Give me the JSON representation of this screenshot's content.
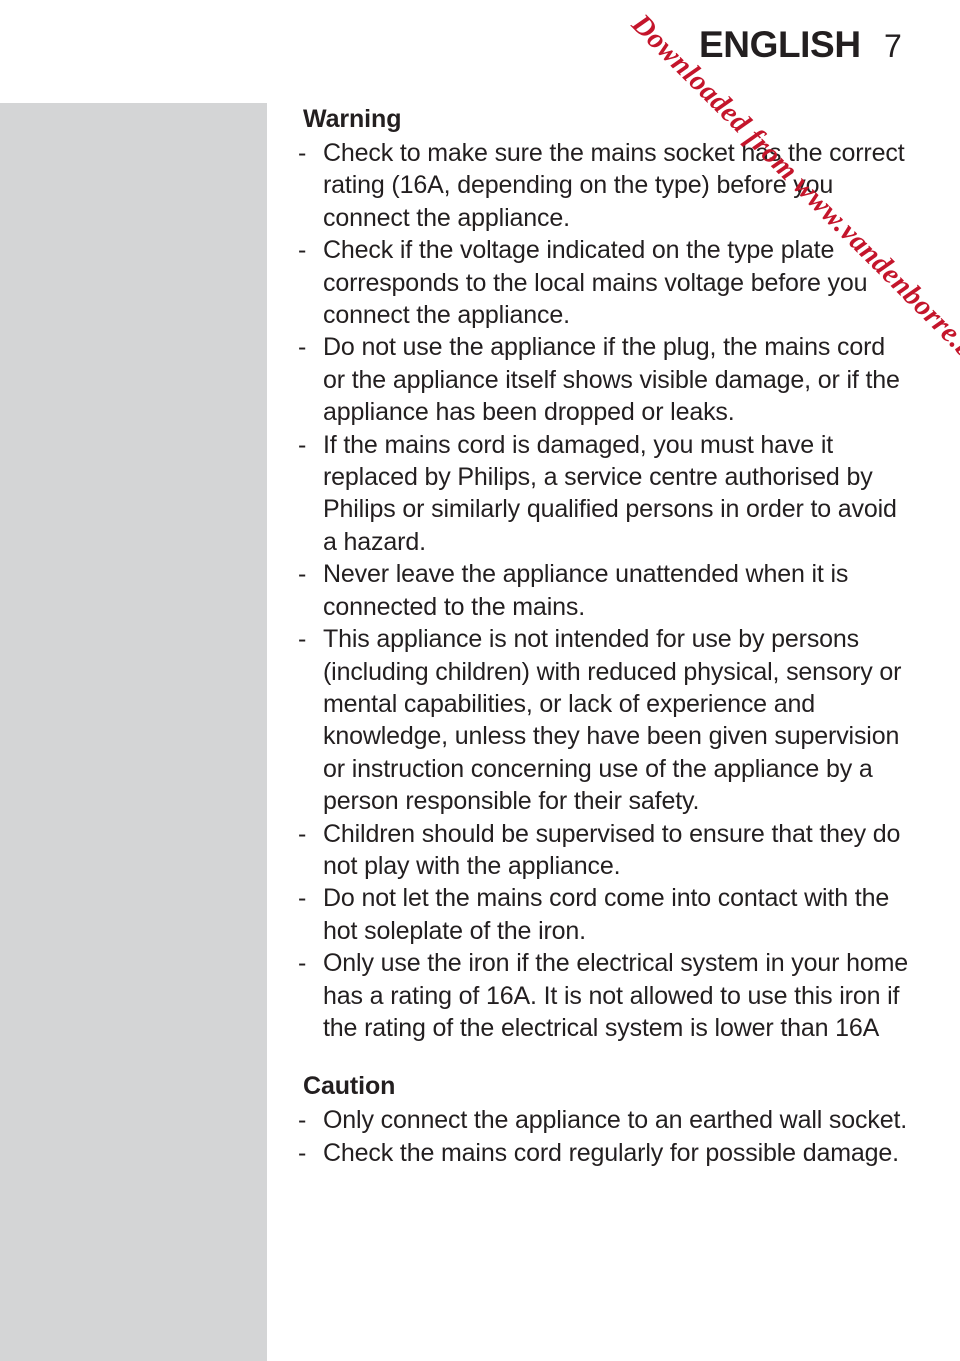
{
  "document": {
    "header": {
      "language": "ENGLISH",
      "page_number": "7"
    },
    "watermark": {
      "text": "Downloaded from www.vandenborre.be",
      "color": "#c4152b"
    },
    "sections": [
      {
        "title": "Warning",
        "bullet_marker": "-",
        "items": [
          "Check to make sure the mains socket has the correct rating (16A, depending on the type) before you connect the appliance.",
          "Check if the voltage indicated on the type plate corresponds to the local mains voltage before you connect the appliance.",
          "Do not use the appliance if the plug, the mains cord or the appliance itself shows visible damage, or if the appliance has been dropped or leaks.",
          "If the mains cord is damaged, you must have it replaced by Philips, a service centre authorised by Philips or similarly qualified persons in order to avoid a hazard.",
          "Never leave the appliance unattended when it is connected to the mains.",
          "This appliance is not intended for use by persons (including children) with reduced physical, sensory or mental capabilities, or lack of experience and knowledge, unless they have been given supervision or instruction concerning use of the appliance by a person responsible for their safety.",
          "Children should be supervised to ensure that they do not play with the appliance.",
          "Do not let the mains cord come into contact with the hot soleplate of the iron.",
          "Only use the iron if the electrical system in your home has a rating of 16A. It is not allowed to use this iron if the rating of the electrical system is lower than 16A"
        ]
      },
      {
        "title": "Caution",
        "bullet_marker": "-",
        "items": [
          "Only connect the appliance to an earthed wall socket.",
          "Check the mains cord regularly for possible damage."
        ]
      }
    ],
    "colors": {
      "text": "#231f20",
      "side_panel": "#d4d5d6",
      "background": "#ffffff"
    }
  }
}
